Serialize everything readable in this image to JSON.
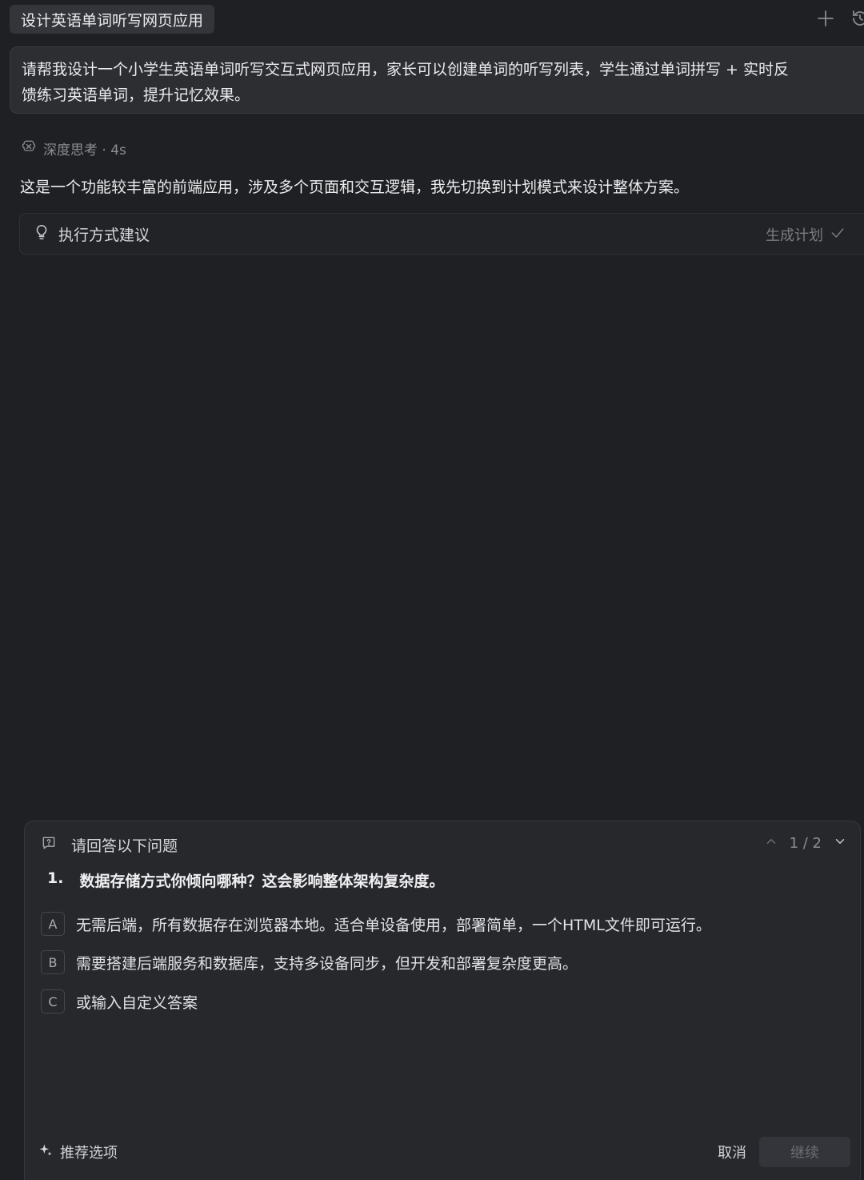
{
  "header": {
    "title": "设计英语单词听写网页应用",
    "add_icon": "plus-icon",
    "history_icon": "history-icon"
  },
  "user_message": {
    "line1": "请帮我设计一个小学生英语单词听写交互式网页应用，家长可以创建单词的听写列表，学生通过单词拼写 + 实时反",
    "line2": "馈练习英语单词，提升记忆效果。"
  },
  "thinking": {
    "label": "深度思考 · 4s",
    "icon": "brain-icon"
  },
  "assistant": {
    "text": "这是一个功能较丰富的前端应用，涉及多个页面和交互逻辑，我先切换到计划模式来设计整体方案。"
  },
  "suggestion": {
    "label": "执行方式建议",
    "status": "生成计划",
    "icon": "lightbulb-icon",
    "status_icon": "check-icon"
  },
  "question_panel": {
    "header": "请回答以下问题",
    "pager": "1 / 2",
    "question_number": "1.",
    "question": "数据存储方式你倾向哪种？这会影响整体架构复杂度。",
    "options": [
      {
        "key": "A",
        "text": "无需后端，所有数据存在浏览器本地。适合单设备使用，部署简单，一个HTML文件即可运行。"
      },
      {
        "key": "B",
        "text": "需要搭建后端服务和数据库，支持多设备同步，但开发和部署复杂度更高。"
      },
      {
        "key": "C",
        "text": "或输入自定义答案"
      }
    ],
    "recommend_label": "推荐选项",
    "cancel_label": "取消",
    "continue_label": "继续"
  }
}
